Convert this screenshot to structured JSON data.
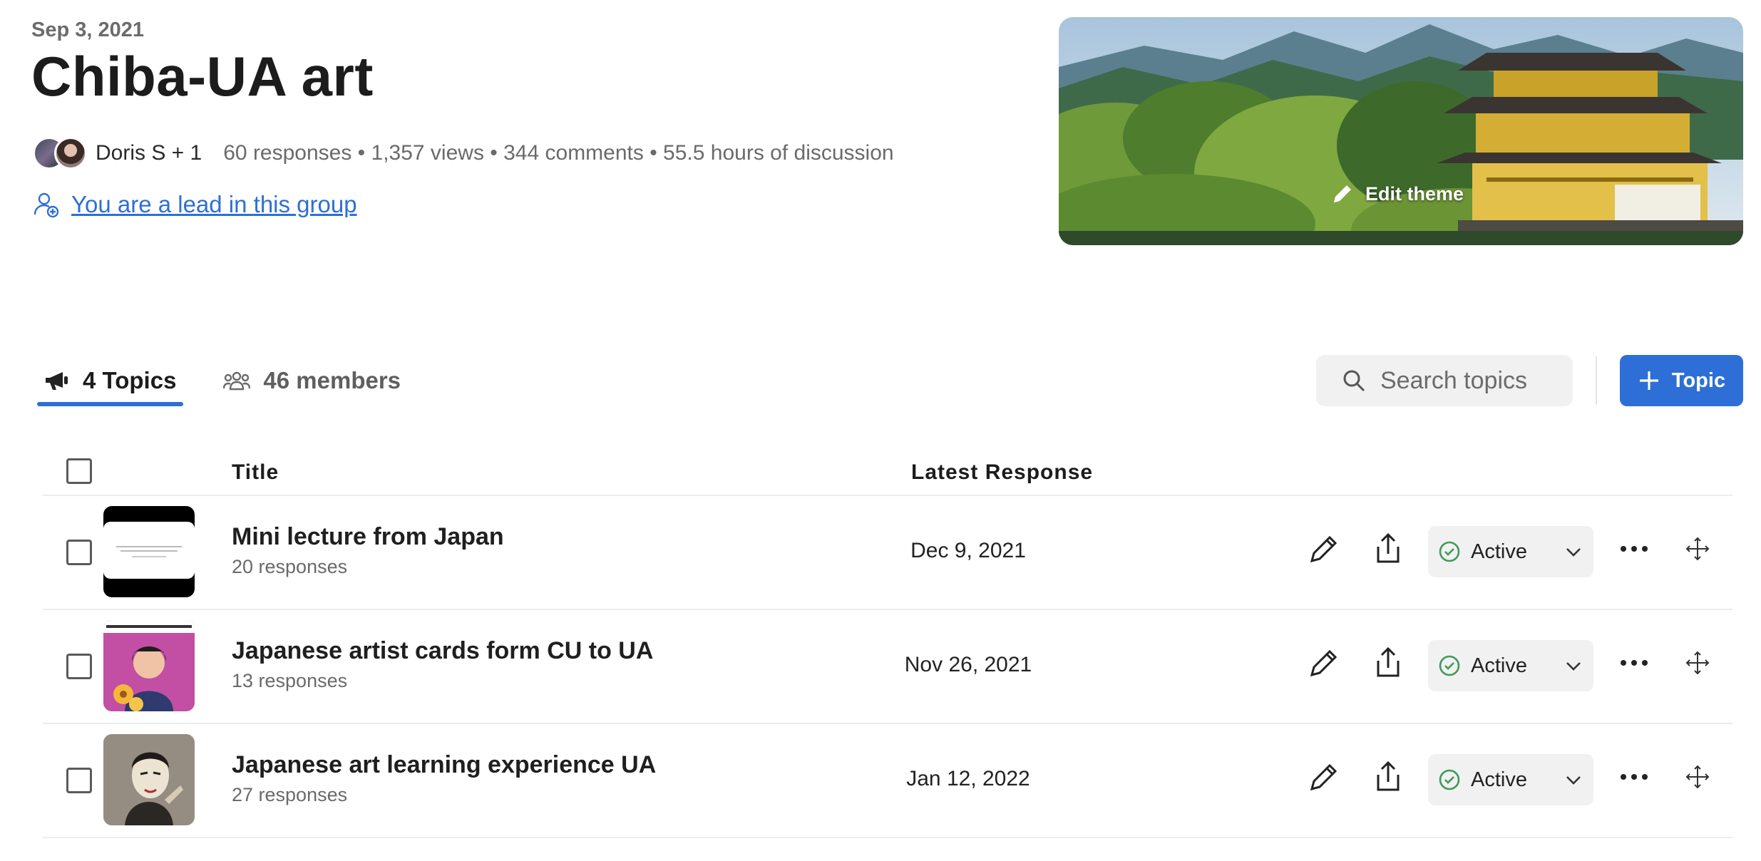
{
  "header": {
    "date": "Sep 3, 2021",
    "title": "Chiba-UA art",
    "owner": "Doris S + 1",
    "stats": "60 responses • 1,357 views • 344 comments • 55.5 hours of discussion",
    "lead_text": "You are a lead in this group",
    "edit_theme_label": "Edit theme"
  },
  "tabs": [
    {
      "label": "4 Topics",
      "icon": "megaphone-icon",
      "active": true
    },
    {
      "label": "46 members",
      "icon": "members-icon",
      "active": false
    }
  ],
  "search": {
    "placeholder": "Search topics"
  },
  "add_button": {
    "label": "Topic",
    "icon": "plus-icon"
  },
  "table": {
    "columns": [
      "Title",
      "Latest Response"
    ],
    "rows": [
      {
        "title": "Mini lecture from Japan",
        "responses": "20 responses",
        "latest": "Dec 9, 2021",
        "status": "Active"
      },
      {
        "title": "Japanese artist cards form CU to UA",
        "responses": "13 responses",
        "latest": "Nov 26, 2021",
        "status": "Active"
      },
      {
        "title": "Japanese art learning experience UA",
        "responses": "27 responses",
        "latest": "Jan 12, 2022",
        "status": "Active"
      }
    ]
  },
  "colors": {
    "accent": "#2d6fd6",
    "status_ok": "#3f9a5a"
  }
}
